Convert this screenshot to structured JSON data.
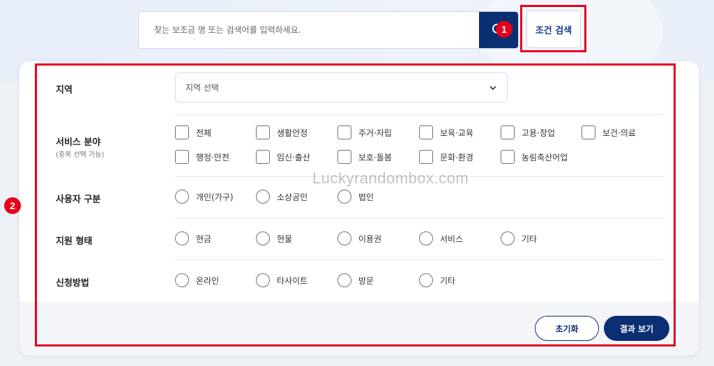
{
  "search": {
    "placeholder": "찾는 보조금 명 또는 검색어를 입력하세요.",
    "condition_button": "조건 검색"
  },
  "markers": {
    "one": "1",
    "two": "2"
  },
  "region": {
    "label": "지역",
    "select_placeholder": "지역 선택"
  },
  "service": {
    "label": "서비스 분야",
    "sublabel": "(중복 선택 가능)",
    "options": [
      "전체",
      "생활안정",
      "주거·자립",
      "보육·교육",
      "고용·창업",
      "보건·의료",
      "행정·안전",
      "임신·출산",
      "보호·돌봄",
      "문화·환경",
      "농림축산어업"
    ]
  },
  "user_type": {
    "label": "사용자 구분",
    "options": [
      "개인(가구)",
      "소상공인",
      "법인"
    ]
  },
  "support_type": {
    "label": "지원 형태",
    "options": [
      "현금",
      "현물",
      "이용권",
      "서비스",
      "기타"
    ]
  },
  "apply_method": {
    "label": "신청방법",
    "options": [
      "온라인",
      "타사이트",
      "방문",
      "기타"
    ]
  },
  "watermark": "Luckyrandombox.com",
  "buttons": {
    "reset": "초기화",
    "results": "결과 보기"
  },
  "colors": {
    "primary": "#0b2f73",
    "highlight": "#e5001c"
  }
}
